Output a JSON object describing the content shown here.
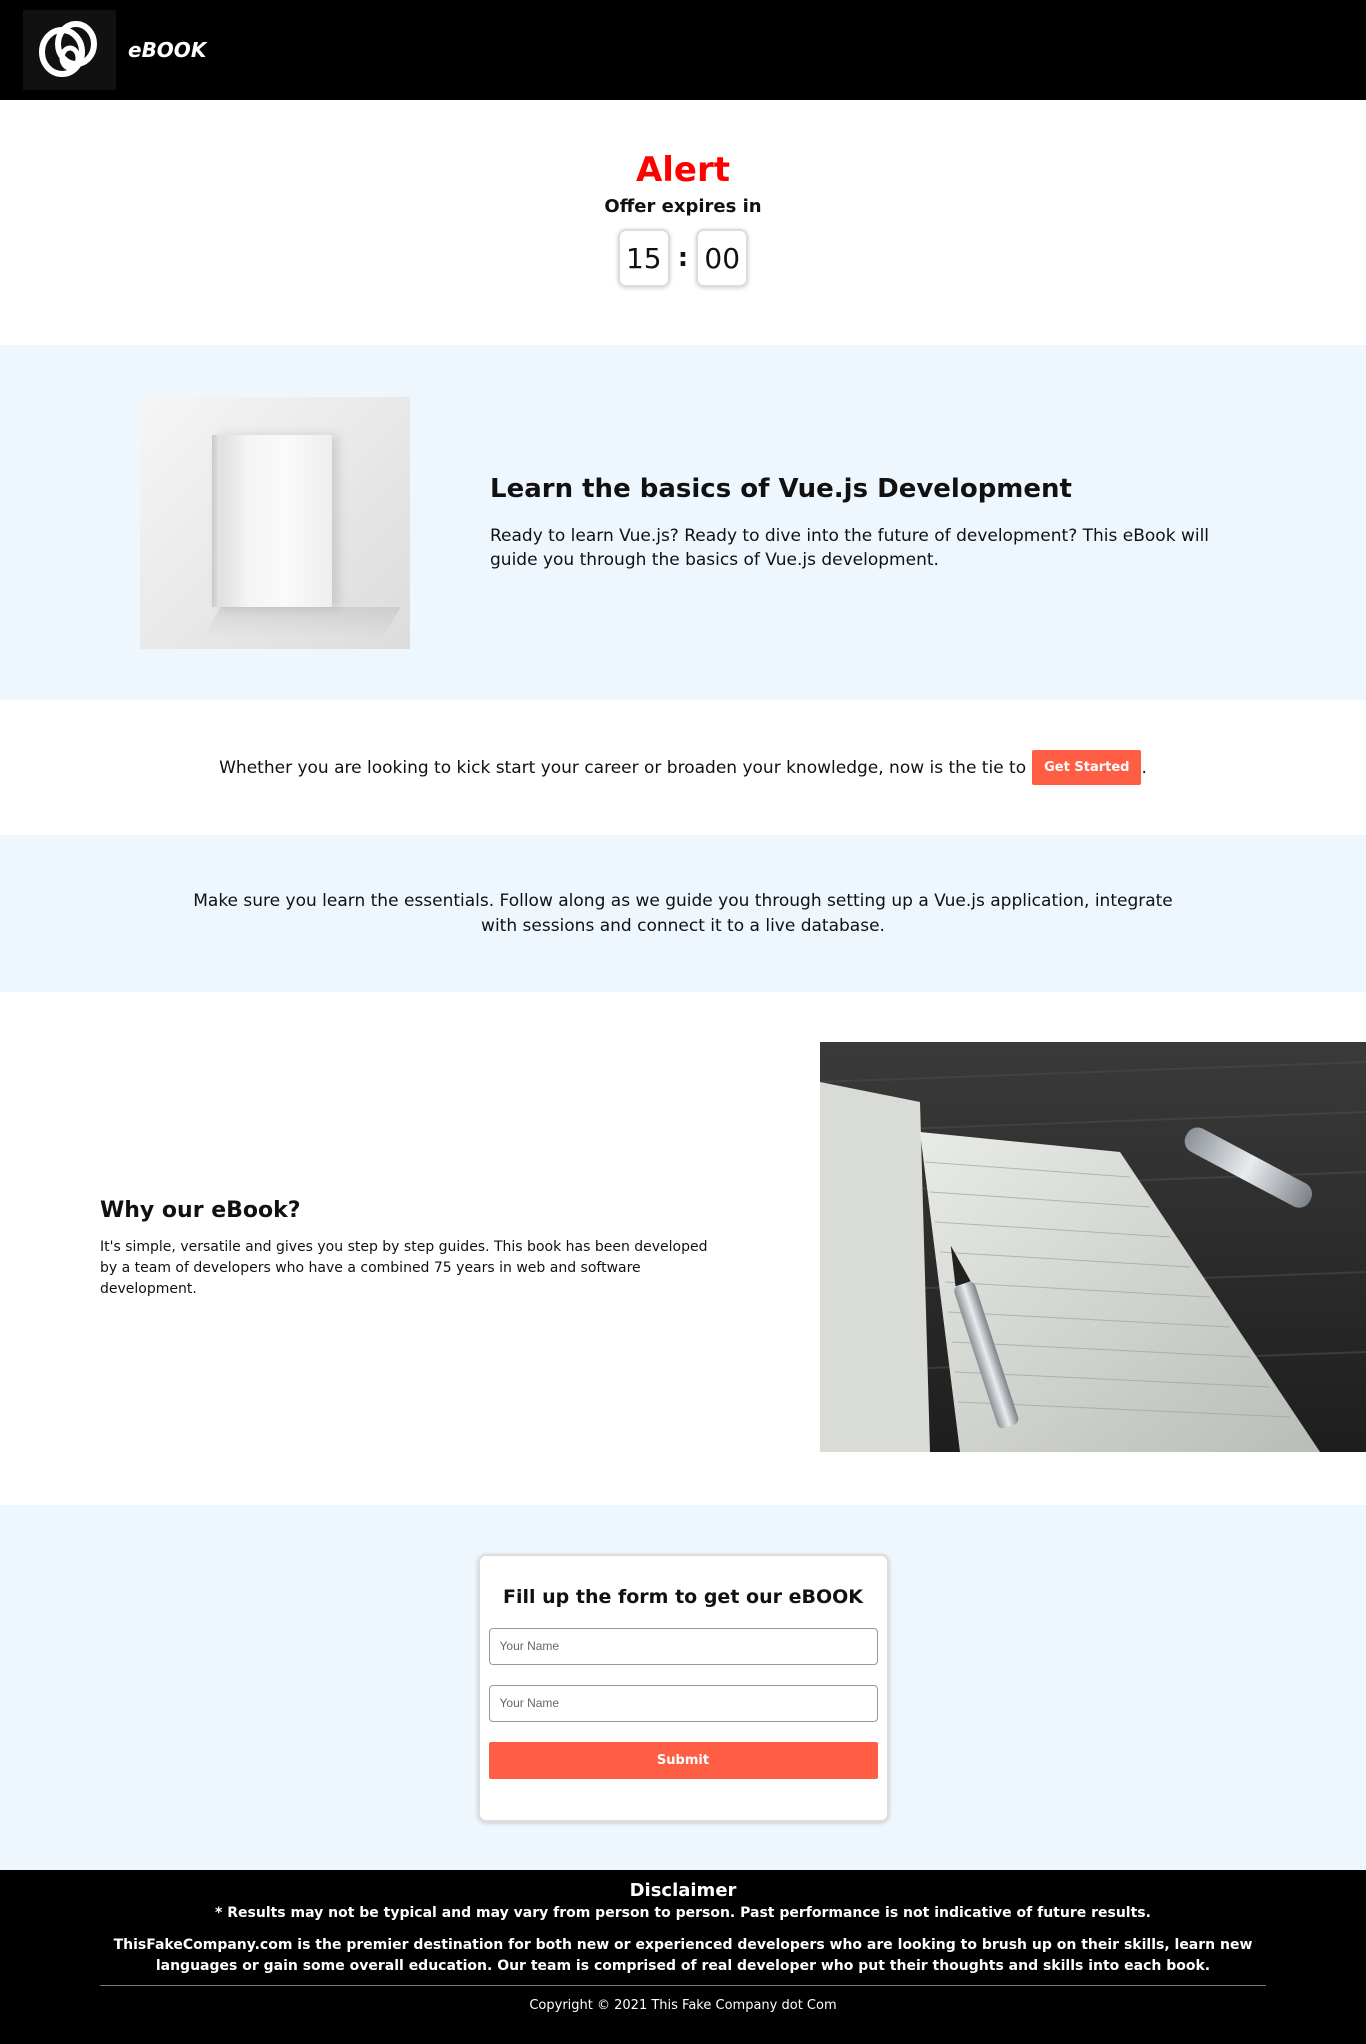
{
  "header": {
    "brand": "eBOOK"
  },
  "alert": {
    "title": "Alert",
    "subtitle": "Offer expires in",
    "minutes": "15",
    "separator": ":",
    "seconds": "00"
  },
  "hero": {
    "title": "Learn the basics of Vue.js Development",
    "description": "Ready to learn Vue.js? Ready to dive into the future of development? This eBook will guide you through the basics of Vue.js development."
  },
  "cta": {
    "text": "Whether you are looking to kick start your career or broaden your knowledge, now is the tie to",
    "button_label": "Get Started",
    "trailing": "."
  },
  "essentials": {
    "text": "Make sure you learn the essentials. Follow along as we guide you through setting up a Vue.js application, integrate with sessions and connect it to a live database."
  },
  "why": {
    "title": "Why our eBook?",
    "description": "It's simple, versatile and gives you step by step guides. This book has been developed by a team of developers who have a combined 75 years in web and software development."
  },
  "form": {
    "title": "Fill up the form to get our eBOOK",
    "field1_placeholder": "Your Name",
    "field2_placeholder": "Your Name",
    "submit_label": "Submit"
  },
  "footer": {
    "disclaimer_title": "Disclaimer",
    "disclaimer_line": "* Results may not be typical and may vary from person to person. Past performance is not indicative of future results.",
    "about": "ThisFakeCompany.com is the premier destination for both new or experienced developers who are looking to brush up on their skills, learn new languages or gain some overall education. Our team is comprised of real developer who put their thoughts and skills into each book.",
    "copyright": "Copyright © 2021 This Fake Company dot Com"
  },
  "colors": {
    "alert_red": "#ff0000",
    "accent": "#ff5e45",
    "section_bg": "#eef6fe"
  }
}
